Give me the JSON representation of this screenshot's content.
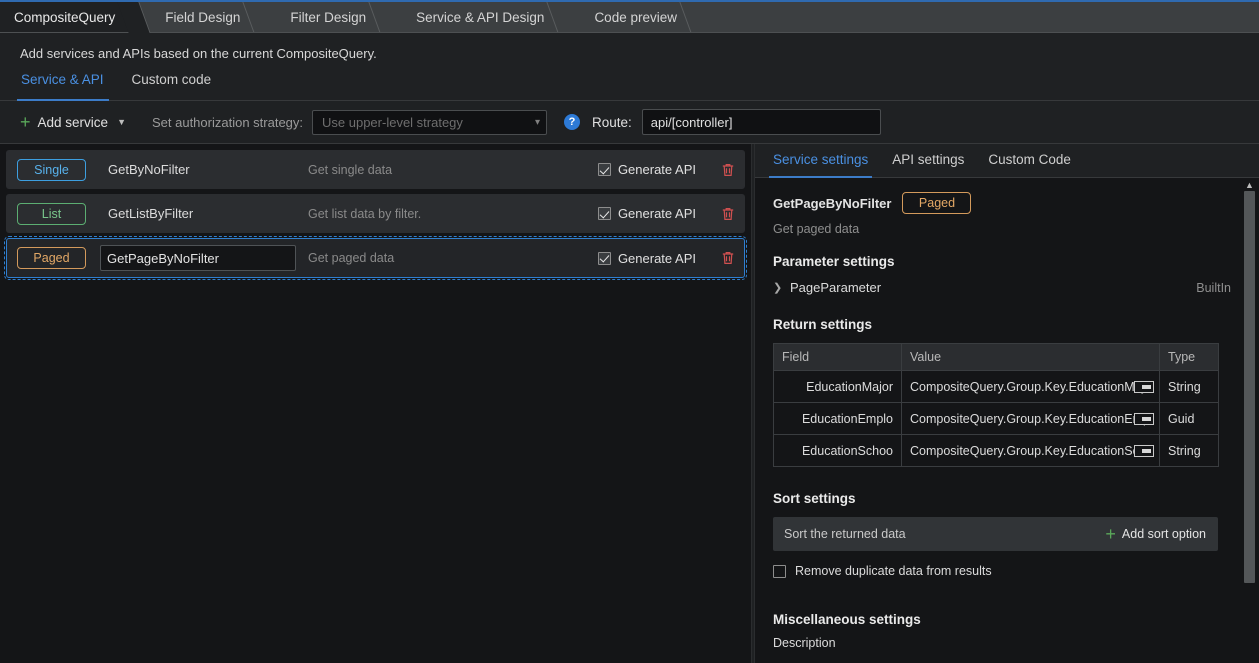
{
  "window": {
    "top_tabs": [
      {
        "label": "CompositeQuery",
        "active": true
      },
      {
        "label": "Field Design",
        "active": false
      },
      {
        "label": "Filter Design",
        "active": false
      },
      {
        "label": "Service & API Design",
        "active": false
      },
      {
        "label": "Code preview",
        "active": false
      }
    ]
  },
  "page": {
    "description": "Add services and APIs based on the current CompositeQuery.",
    "sub_tabs": [
      {
        "label": "Service & API",
        "active": true
      },
      {
        "label": "Custom code",
        "active": false
      }
    ]
  },
  "toolbar": {
    "add_service_label": "Add service",
    "add_service_icon": "plus-icon",
    "add_service_caret": "chevron-down-icon",
    "authorization_label": "Set authorization strategy:",
    "authorization_placeholder": "Use upper-level strategy",
    "authorization_value": "",
    "help_icon_glyph": "?",
    "route_label": "Route:",
    "route_value": "api/[controller]"
  },
  "services": [
    {
      "badge": "Single",
      "badge_kind": "single",
      "name": "GetByNoFilter",
      "description": "Get single data",
      "generate_api_label": "Generate API",
      "generate_api_checked": true,
      "selected": false,
      "editing": false
    },
    {
      "badge": "List",
      "badge_kind": "list",
      "name": "GetListByFilter",
      "description": "Get list data by filter.",
      "generate_api_label": "Generate API",
      "generate_api_checked": true,
      "selected": false,
      "editing": false
    },
    {
      "badge": "Paged",
      "badge_kind": "paged",
      "name": "GetPageByNoFilter",
      "description": "Get paged data",
      "generate_api_label": "Generate API",
      "generate_api_checked": true,
      "selected": true,
      "editing": true
    }
  ],
  "details": {
    "tabs": [
      {
        "label": "Service settings",
        "active": true
      },
      {
        "label": "API settings",
        "active": false
      },
      {
        "label": "Custom Code",
        "active": false
      }
    ],
    "service_name": "GetPageByNoFilter",
    "service_badge": "Paged",
    "service_description": "Get paged data",
    "parameter_settings": {
      "title": "Parameter settings",
      "rows": [
        {
          "name": "PageParameter",
          "kind": "BuiltIn"
        }
      ]
    },
    "return_settings": {
      "title": "Return settings",
      "columns": [
        "Field",
        "Value",
        "Type"
      ],
      "rows": [
        {
          "field": "EducationMajor",
          "value": "CompositeQuery.Group.Key.EducationMajor",
          "type": "String"
        },
        {
          "field": "EducationEmplo",
          "value": "CompositeQuery.Group.Key.EducationEmplo",
          "type": "Guid"
        },
        {
          "field": "EducationSchoo",
          "value": "CompositeQuery.Group.Key.EducationSchoo",
          "type": "String"
        }
      ]
    },
    "sort_settings": {
      "title": "Sort settings",
      "placeholder": "Sort the returned data",
      "add_label": "Add sort option",
      "remove_duplicate_label": "Remove duplicate data from results",
      "remove_duplicate_checked": false
    },
    "misc_settings": {
      "title": "Miscellaneous settings",
      "description_label": "Description"
    }
  },
  "colors": {
    "accent_blue": "#3c7cc8",
    "badge_single": "#3d9fe0",
    "badge_list": "#5cae72",
    "badge_paged": "#d39a5c",
    "delete_red": "#d05050",
    "plus_green": "#5aa85a"
  }
}
